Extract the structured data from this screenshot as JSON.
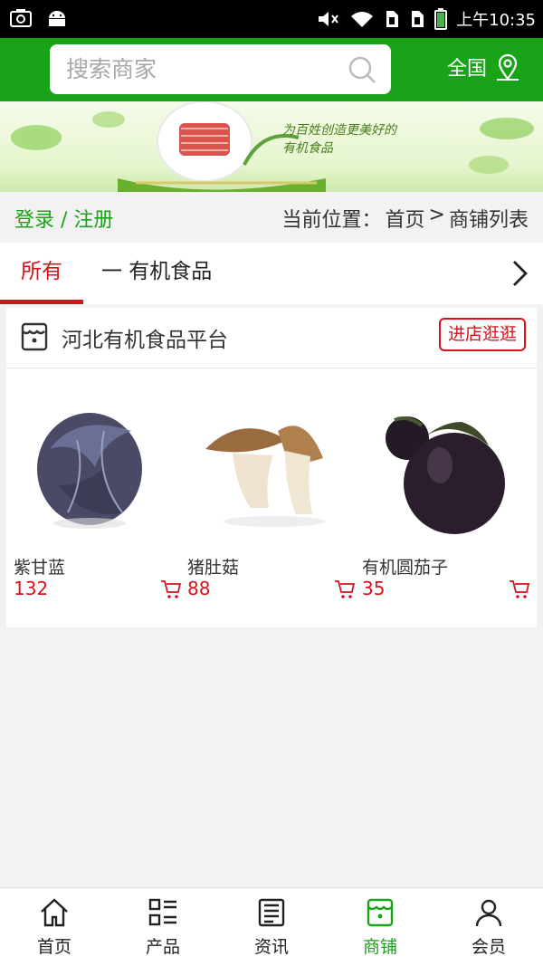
{
  "status_bar": {
    "time": "上午10:35"
  },
  "header": {
    "search_placeholder": "搜索商家",
    "region_label": "全国"
  },
  "banner": {
    "slogan_line1": "为百姓创造更美好的",
    "slogan_line2": "有机食品"
  },
  "breadcrumb": {
    "login_label": "登录 / 注册",
    "path_label": "当前位置：",
    "home": "首页",
    "separator": ">",
    "current": "商铺列表"
  },
  "tabs": {
    "all_label": "所有",
    "category_label": "一 有机食品"
  },
  "shop": {
    "name": "河北有机食品平台",
    "enter_label": "进店逛逛",
    "products": [
      {
        "name": "紫甘蓝",
        "price": "132"
      },
      {
        "name": "猪肚菇",
        "price": "88"
      },
      {
        "name": "有机圆茄子",
        "price": "35"
      }
    ]
  },
  "bottom_nav": [
    {
      "label": "首页",
      "icon": "home-icon",
      "active": false
    },
    {
      "label": "产品",
      "icon": "product-list-icon",
      "active": false
    },
    {
      "label": "资讯",
      "icon": "news-icon",
      "active": false
    },
    {
      "label": "商铺",
      "icon": "store-icon",
      "active": true
    },
    {
      "label": "会员",
      "icon": "user-icon",
      "active": false
    }
  ],
  "colors": {
    "brand_green": "#19a319",
    "accent_red": "#d6121b"
  }
}
